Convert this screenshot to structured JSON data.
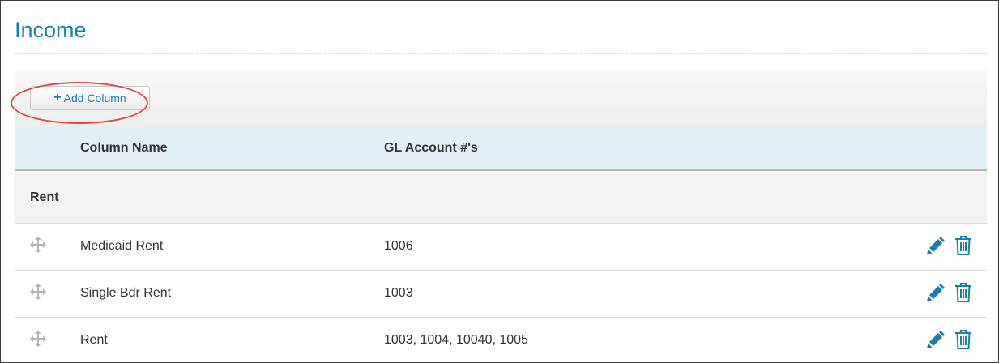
{
  "page": {
    "title": "Income"
  },
  "toolbar": {
    "add_column_label": "Add Column",
    "add_icon": "plus-icon"
  },
  "table": {
    "headers": {
      "column_name": "Column Name",
      "gl_accounts": "GL Account #'s"
    },
    "group": {
      "label": "Rent"
    },
    "rows": [
      {
        "column_name": "Medicaid Rent",
        "gl_accounts": "1006"
      },
      {
        "column_name": "Single Bdr Rent",
        "gl_accounts": "1003"
      },
      {
        "column_name": "Rent",
        "gl_accounts": "1003, 1004, 10040, 1005"
      }
    ]
  },
  "colors": {
    "accent": "#1a7fb0",
    "header_bg": "#e2eff4",
    "highlight": "#e04848",
    "drag_icon": "#b5b5b5"
  },
  "icons": {
    "drag": "move-icon",
    "edit": "pencil-icon",
    "delete": "trash-icon"
  }
}
